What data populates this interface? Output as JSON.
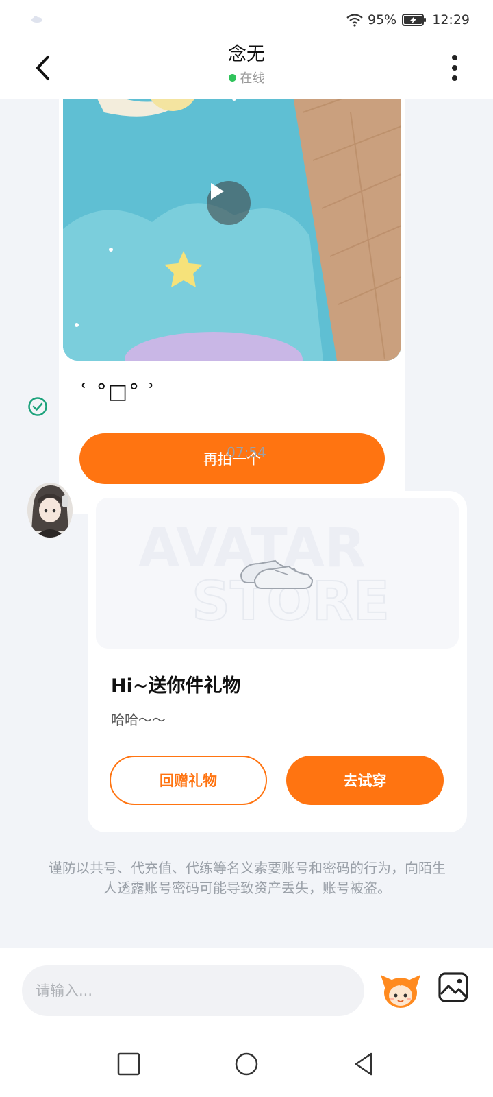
{
  "status_bar": {
    "battery_percent": "95%",
    "time": "12:29",
    "icons": [
      "cloud-icon",
      "wifi-icon",
      "battery-charging-icon"
    ]
  },
  "header": {
    "title": "念无",
    "status": "在线",
    "status_color": "#2fc35b",
    "icons": [
      "back-arrow-icon",
      "more-vert-icon"
    ]
  },
  "messages": {
    "video_message": {
      "emoticon": "ʿ °□° ʾ",
      "retake_label": "再拍一个",
      "icons": [
        "play-icon",
        "sent-check-icon"
      ]
    },
    "timestamp": "07:54",
    "gift_message": {
      "title": "Hi~送你件礼物",
      "subtitle": "哈哈～～",
      "return_gift_label": "回赠礼物",
      "try_on_label": "去试穿",
      "image_watermark": "AVATAR STORE"
    }
  },
  "warning_text": "谨防以共号、代充值、代练等名义索要账号和密码的行为，向陌生人透露账号密码可能导致资产丢失，账号被盗。",
  "input": {
    "placeholder": "请输入..."
  },
  "colors": {
    "accent": "#ff7411",
    "background": "#f2f4f8",
    "check": "#1aa17a"
  }
}
